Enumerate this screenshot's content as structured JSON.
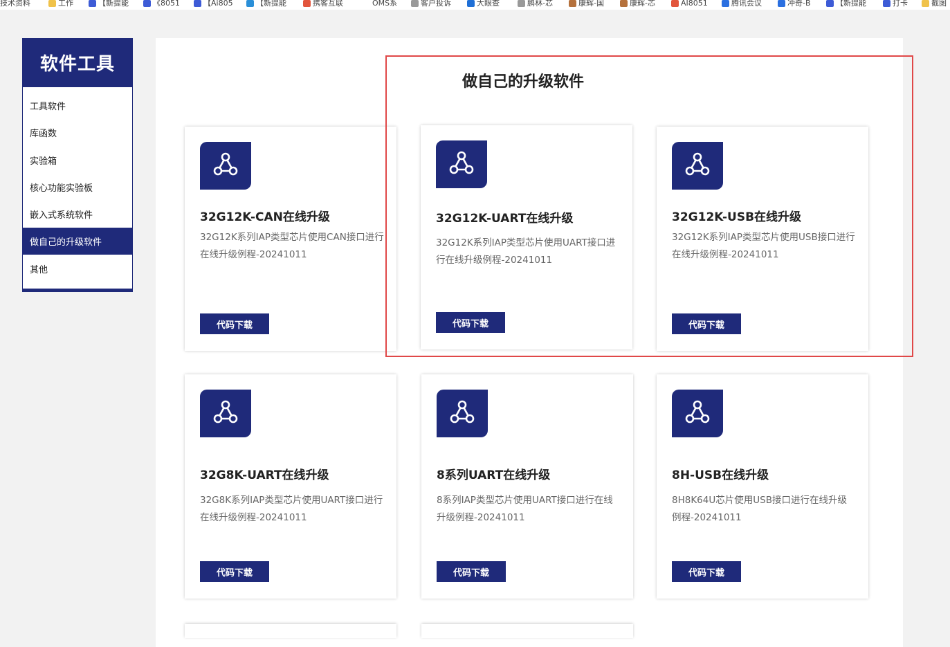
{
  "bookmarks": [
    {
      "label": "技术资料",
      "color": "#f0c24a"
    },
    {
      "label": "工作",
      "color": "#f0c24a"
    },
    {
      "label": "【新提能",
      "color": "#3d5bd6"
    },
    {
      "label": "《8051",
      "color": "#3d5bd6"
    },
    {
      "label": "【Ai805",
      "color": "#3d5bd6"
    },
    {
      "label": "【新提能",
      "color": "#2a8fd8"
    },
    {
      "label": "携客互联",
      "color": "#e2553c"
    },
    {
      "label": "OMS系",
      "color": "#ffffff"
    },
    {
      "label": "客户投诉",
      "color": "#999999"
    },
    {
      "label": "大眼查",
      "color": "#1f6fd6"
    },
    {
      "label": "鹏林-芯",
      "color": "#999999"
    },
    {
      "label": "康辉-国",
      "color": "#b5713c"
    },
    {
      "label": "康辉-芯",
      "color": "#b5713c"
    },
    {
      "label": "AI8051",
      "color": "#e2553c"
    },
    {
      "label": "腾讯会议",
      "color": "#2a6fe0"
    },
    {
      "label": "冲奇-B",
      "color": "#2a6fe0"
    },
    {
      "label": "【新提能",
      "color": "#3d5bd6"
    },
    {
      "label": "打卡",
      "color": "#3d5bd6"
    },
    {
      "label": "截图",
      "color": "#f0c24a"
    }
  ],
  "sidebar": {
    "title": "软件工具",
    "items": [
      {
        "label": "工具软件"
      },
      {
        "label": "库函数"
      },
      {
        "label": "实验箱"
      },
      {
        "label": "核心功能实验板"
      },
      {
        "label": "嵌入式系统软件"
      },
      {
        "label": "做自己的升级软件"
      },
      {
        "label": "其他"
      }
    ],
    "active_index": 5
  },
  "main": {
    "title": "做自己的升级软件",
    "download_label": "代码下载",
    "cards": [
      {
        "title": "32G12K-CAN在线升级",
        "desc": "32G12K系列IAP类型芯片使用CAN接口进行在线升级例程-20241011"
      },
      {
        "title": "32G12K-UART在线升级",
        "desc": "32G12K系列IAP类型芯片使用UART接口进行在线升级例程-20241011"
      },
      {
        "title": "32G12K-USB在线升级",
        "desc": "32G12K系列IAP类型芯片使用USB接口进行在线升级例程-20241011"
      },
      {
        "title": "32G8K-UART在线升级",
        "desc": "32G8K系列IAP类型芯片使用UART接口进行在线升级例程-20241011"
      },
      {
        "title": "8系列UART在线升级",
        "desc": "8系列IAP类型芯片使用UART接口进行在线升级例程-20241011"
      },
      {
        "title": "8H-USB在线升级",
        "desc": "8H8K64U芯片使用USB接口进行在线升级例程-20241011"
      }
    ]
  },
  "colors": {
    "brand": "#1f2a7a",
    "highlight": "#e04848"
  },
  "icons": {
    "card_logo": "share-nodes-icon"
  }
}
